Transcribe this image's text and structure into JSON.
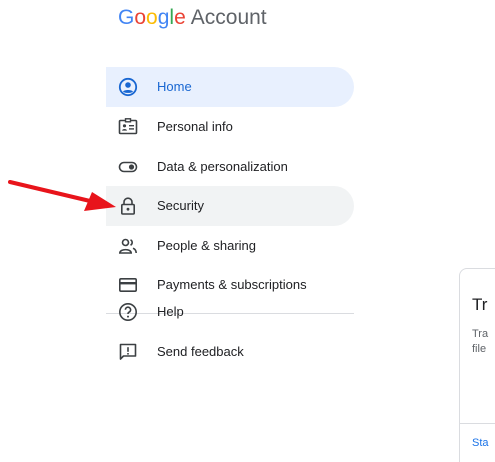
{
  "header": {
    "logo_letters": [
      "G",
      "o",
      "o",
      "g",
      "l",
      "e"
    ],
    "logo_colors": [
      "#4285F4",
      "#EA4335",
      "#FBBC05",
      "#4285F4",
      "#34A853",
      "#EA4335"
    ],
    "product_name": "Account"
  },
  "sidebar": {
    "items": [
      {
        "label": "Home",
        "icon": "account-circle-icon",
        "state": "selected"
      },
      {
        "label": "Personal info",
        "icon": "id-card-icon"
      },
      {
        "label": "Data & personalization",
        "icon": "toggle-icon"
      },
      {
        "label": "Security",
        "icon": "lock-icon",
        "state": "hovered"
      },
      {
        "label": "People & sharing",
        "icon": "people-icon"
      },
      {
        "label": "Payments & subscriptions",
        "icon": "credit-card-icon"
      },
      {
        "label": "Help",
        "icon": "help-circle-icon"
      },
      {
        "label": "Send feedback",
        "icon": "feedback-icon"
      }
    ]
  },
  "card": {
    "title": "Tr",
    "description_lines": [
      "Tra",
      "file"
    ],
    "link_label": "Sta"
  },
  "colors": {
    "accent": "#1967d2",
    "selected_bg": "#e8f0fe",
    "hover_bg": "#f1f3f4",
    "annotation_arrow": "#e8141b"
  }
}
